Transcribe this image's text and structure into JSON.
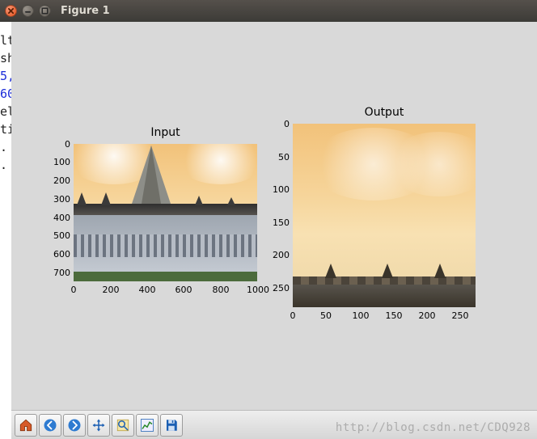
{
  "window": {
    "title": "Figure 1"
  },
  "background_fragments": {
    "lines": [
      "lt",
      "sh",
      "",
      "5,",
      "60",
      "el",
      "ti",
      "",
      ".",
      "."
    ]
  },
  "chart_data": [
    {
      "type": "image",
      "title": "Input",
      "x_range": [
        0,
        1000
      ],
      "y_range": [
        0,
        750
      ],
      "x_ticks": [
        0,
        200,
        400,
        600,
        800,
        1000
      ],
      "y_ticks": [
        0,
        100,
        200,
        300,
        400,
        500,
        600,
        700
      ],
      "y_inverted": true,
      "content": "photograph of a gothic cathedral with tall central spire under orange sky, green lawn foreground"
    },
    {
      "type": "image",
      "title": "Output",
      "x_range": [
        0,
        275
      ],
      "y_range": [
        0,
        280
      ],
      "x_ticks": [
        0,
        50,
        100,
        150,
        200,
        250
      ],
      "y_ticks": [
        0,
        50,
        100,
        150,
        200,
        250
      ],
      "y_inverted": true,
      "content": "cropped top region: orange sky with faint clouds and dark roofline along bottom edge"
    }
  ],
  "toolbar": {
    "items": [
      {
        "name": "home-icon",
        "label": "Home"
      },
      {
        "name": "back-icon",
        "label": "Back"
      },
      {
        "name": "forward-icon",
        "label": "Forward"
      },
      {
        "name": "pan-icon",
        "label": "Pan"
      },
      {
        "name": "zoom-icon",
        "label": "Zoom"
      },
      {
        "name": "subplots-icon",
        "label": "Configure subplots"
      },
      {
        "name": "save-icon",
        "label": "Save"
      }
    ]
  },
  "watermark": "http://blog.csdn.net/CDQ928"
}
